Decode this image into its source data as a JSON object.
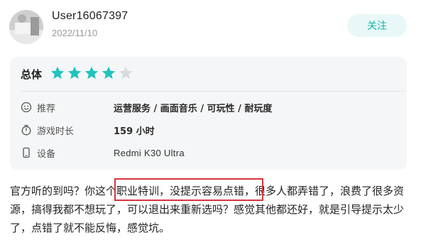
{
  "user": {
    "name": "User16067397",
    "date": "2022/11/10"
  },
  "actions": {
    "follow_label": "关注"
  },
  "rating": {
    "label": "总体",
    "stars": 4,
    "max": 5,
    "star_color": "#1fc3c0",
    "empty_star_color": "#d8dcdf"
  },
  "details": [
    {
      "icon": "smiley-icon",
      "label": "推荐",
      "value": "运营服务 / 画面音乐 / 可玩性 / 耐玩度"
    },
    {
      "icon": "timer-icon",
      "label": "游戏时长",
      "value": "159 小时"
    },
    {
      "icon": "phone-icon",
      "label": "设备",
      "value": "Redmi K30 Ultra"
    }
  ],
  "review": {
    "text": "官方听的到吗？你这个职业特训，没提示容易点错，很多人都弄错了，浪费了很多资源，搞得我都不想玩了，可以退出来重新选吗？感觉其他都还好，就是引导提示太少了，点错了就不能反悔，感觉坑。"
  },
  "colors": {
    "accent": "#16b3ad",
    "highlight_border": "#d9343d"
  }
}
